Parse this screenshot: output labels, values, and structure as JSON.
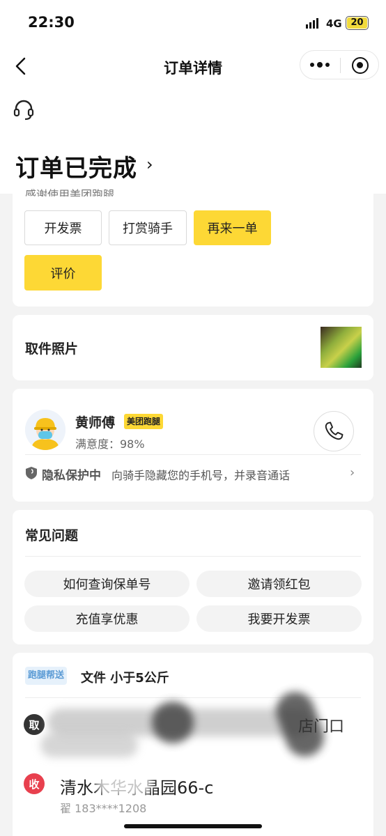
{
  "status_bar": {
    "time": "22:30",
    "network": "4G",
    "battery": "20"
  },
  "nav": {
    "title": "订单详情"
  },
  "order": {
    "status": "订单已完成",
    "thanks": "感谢使用美团跑腿"
  },
  "actions": {
    "invoice": "开发票",
    "tip": "打赏骑手",
    "reorder": "再来一单",
    "review": "评价"
  },
  "pickup_photo": {
    "title": "取件照片"
  },
  "rider": {
    "name": "黄师傅",
    "brand": "美团跑腿",
    "satisfaction": "满意度：98%",
    "privacy_title": "隐私保护中",
    "privacy_desc": "向骑手隐藏您的手机号，并录音通话"
  },
  "faq": {
    "title": "常见问题",
    "items": [
      "如何查询保单号",
      "邀请领红包",
      "充值享优惠",
      "我要开发票"
    ]
  },
  "delivery": {
    "service_tag": "跑腿帮送",
    "item_info": "文件  小于5公斤",
    "pickup_badge": "取",
    "pickup_suffix": "店门口",
    "receive_badge": "收",
    "receive_address": "清水木华水晶园66-c",
    "receive_contact": "翟  183****1208"
  },
  "colors": {
    "accent": "#fdd835",
    "receive": "#e8404e",
    "tag_blue": "#5b9bd5"
  }
}
